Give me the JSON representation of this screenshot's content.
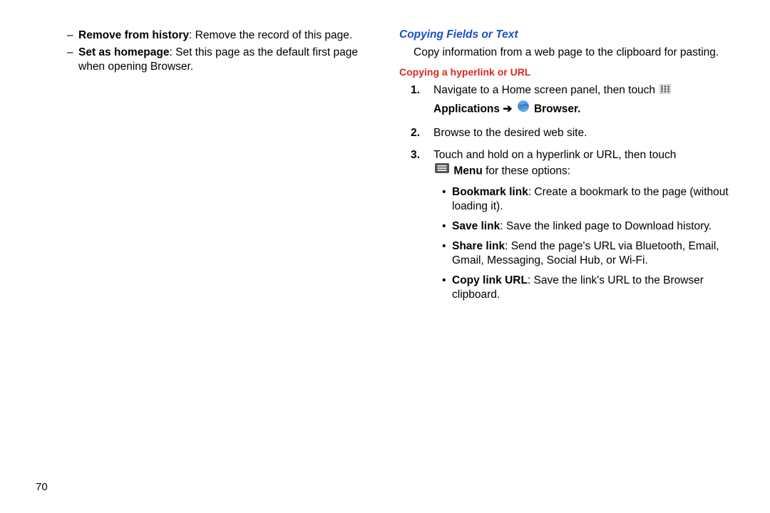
{
  "page_number": "70",
  "left_column": {
    "dash_items": [
      {
        "label": "Remove from history",
        "desc": ": Remove the record of this page."
      },
      {
        "label": "Set as homepage",
        "desc": ": Set this page as the default first page when opening Browser."
      }
    ]
  },
  "right_column": {
    "section_title": "Copying Fields or Text",
    "intro": "Copy information from a web page to the clipboard for pasting.",
    "sub_title": "Copying a hyperlink or URL",
    "steps": [
      {
        "num": "1.",
        "text": "Navigate to a Home screen panel, then touch",
        "app_prefix": "Applications",
        "arrow": "➔",
        "app_suffix": "Browser",
        "trailing_period": "."
      },
      {
        "num": "2.",
        "text": "Browse to the desired web site."
      },
      {
        "num": "3.",
        "text": "Touch and hold on a hyperlink or URL, then touch",
        "menu_label": "Menu",
        "menu_rest": " for these options:"
      }
    ],
    "bullets": [
      {
        "label": "Bookmark link",
        "desc": ": Create a bookmark to the page (without loading it)."
      },
      {
        "label": "Save link",
        "desc": ": Save the linked page to Download history."
      },
      {
        "label": "Share link",
        "desc": ": Send the page's URL via Bluetooth, Email, Gmail, Messaging, Social Hub, or Wi-Fi."
      },
      {
        "label": "Copy link URL",
        "desc": ": Save the link's URL to the Browser clipboard."
      }
    ]
  }
}
